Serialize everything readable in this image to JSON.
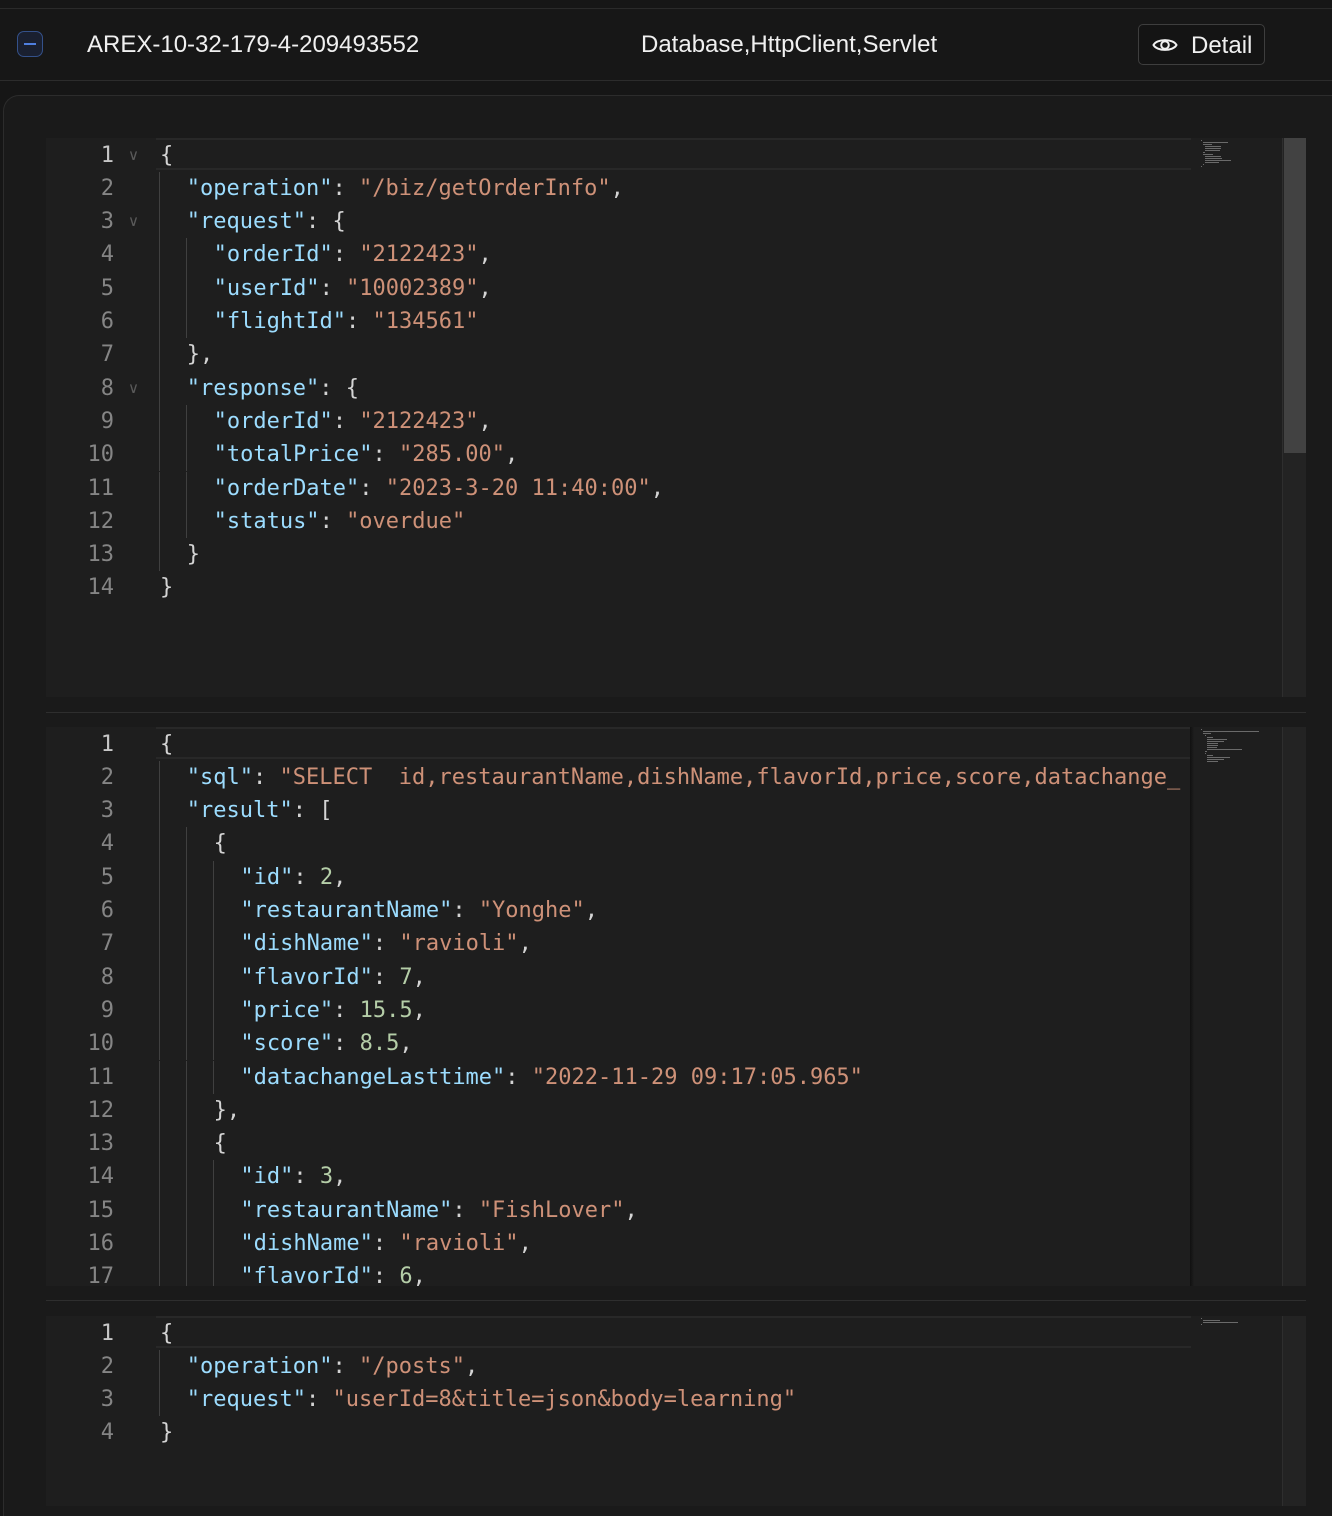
{
  "header": {
    "record_id": "AREX-10-32-179-4-209493552",
    "categories": "Database,HttpClient,Servlet",
    "detail_label": "Detail"
  },
  "editors": [
    {
      "lines": [
        [
          [
            "p",
            "{"
          ]
        ],
        [
          [
            "k",
            "\"operation\""
          ],
          [
            "p",
            ": "
          ],
          [
            "s",
            "\"/biz/getOrderInfo\""
          ],
          [
            "p",
            ","
          ]
        ],
        [
          [
            "k",
            "\"request\""
          ],
          [
            "p",
            ": {"
          ]
        ],
        [
          [
            "k",
            "\"orderId\""
          ],
          [
            "p",
            ": "
          ],
          [
            "s",
            "\"2122423\""
          ],
          [
            "p",
            ","
          ]
        ],
        [
          [
            "k",
            "\"userId\""
          ],
          [
            "p",
            ": "
          ],
          [
            "s",
            "\"10002389\""
          ],
          [
            "p",
            ","
          ]
        ],
        [
          [
            "k",
            "\"flightId\""
          ],
          [
            "p",
            ": "
          ],
          [
            "s",
            "\"134561\""
          ]
        ],
        [
          [
            "p",
            "},"
          ]
        ],
        [
          [
            "k",
            "\"response\""
          ],
          [
            "p",
            ": {"
          ]
        ],
        [
          [
            "k",
            "\"orderId\""
          ],
          [
            "p",
            ": "
          ],
          [
            "s",
            "\"2122423\""
          ],
          [
            "p",
            ","
          ]
        ],
        [
          [
            "k",
            "\"totalPrice\""
          ],
          [
            "p",
            ": "
          ],
          [
            "s",
            "\"285.00\""
          ],
          [
            "p",
            ","
          ]
        ],
        [
          [
            "k",
            "\"orderDate\""
          ],
          [
            "p",
            ": "
          ],
          [
            "s",
            "\"2023-3-20 11:40:00\""
          ],
          [
            "p",
            ","
          ]
        ],
        [
          [
            "k",
            "\"status\""
          ],
          [
            "p",
            ": "
          ],
          [
            "s",
            "\"overdue\""
          ]
        ],
        [
          [
            "p",
            "}"
          ]
        ],
        [
          [
            "p",
            "}"
          ]
        ]
      ]
    },
    {
      "lines": [
        [
          [
            "p",
            "{"
          ]
        ],
        [
          [
            "k",
            "\"sql\""
          ],
          [
            "p",
            ": "
          ],
          [
            "s",
            "\"SELECT  id,restaurantName,dishName,flavorId,price,score,datachange_"
          ]
        ],
        [
          [
            "k",
            "\"result\""
          ],
          [
            "p",
            ": ["
          ]
        ],
        [
          [
            "p",
            "{"
          ]
        ],
        [
          [
            "k",
            "\"id\""
          ],
          [
            "p",
            ": "
          ],
          [
            "n",
            "2"
          ],
          [
            "p",
            ","
          ]
        ],
        [
          [
            "k",
            "\"restaurantName\""
          ],
          [
            "p",
            ": "
          ],
          [
            "s",
            "\"Yonghe\""
          ],
          [
            "p",
            ","
          ]
        ],
        [
          [
            "k",
            "\"dishName\""
          ],
          [
            "p",
            ": "
          ],
          [
            "s",
            "\"ravioli\""
          ],
          [
            "p",
            ","
          ]
        ],
        [
          [
            "k",
            "\"flavorId\""
          ],
          [
            "p",
            ": "
          ],
          [
            "n",
            "7"
          ],
          [
            "p",
            ","
          ]
        ],
        [
          [
            "k",
            "\"price\""
          ],
          [
            "p",
            ": "
          ],
          [
            "n",
            "15.5"
          ],
          [
            "p",
            ","
          ]
        ],
        [
          [
            "k",
            "\"score\""
          ],
          [
            "p",
            ": "
          ],
          [
            "n",
            "8.5"
          ],
          [
            "p",
            ","
          ]
        ],
        [
          [
            "k",
            "\"datachangeLasttime\""
          ],
          [
            "p",
            ": "
          ],
          [
            "s",
            "\"2022-11-29 09:17:05.965\""
          ]
        ],
        [
          [
            "p",
            "},"
          ]
        ],
        [
          [
            "p",
            "{"
          ]
        ],
        [
          [
            "k",
            "\"id\""
          ],
          [
            "p",
            ": "
          ],
          [
            "n",
            "3"
          ],
          [
            "p",
            ","
          ]
        ],
        [
          [
            "k",
            "\"restaurantName\""
          ],
          [
            "p",
            ": "
          ],
          [
            "s",
            "\"FishLover\""
          ],
          [
            "p",
            ","
          ]
        ],
        [
          [
            "k",
            "\"dishName\""
          ],
          [
            "p",
            ": "
          ],
          [
            "s",
            "\"ravioli\""
          ],
          [
            "p",
            ","
          ]
        ],
        [
          [
            "k",
            "\"flavorId\""
          ],
          [
            "p",
            ": "
          ],
          [
            "n",
            "6"
          ],
          [
            "p",
            ","
          ]
        ]
      ]
    },
    {
      "lines": [
        [
          [
            "p",
            "{"
          ]
        ],
        [
          [
            "k",
            "\"operation\""
          ],
          [
            "p",
            ": "
          ],
          [
            "s",
            "\"/posts\""
          ],
          [
            "p",
            ","
          ]
        ],
        [
          [
            "k",
            "\"request\""
          ],
          [
            "p",
            ": "
          ],
          [
            "s",
            "\"userId=8&title=json&body=learning\""
          ]
        ],
        [
          [
            "p",
            "}"
          ]
        ]
      ]
    }
  ]
}
